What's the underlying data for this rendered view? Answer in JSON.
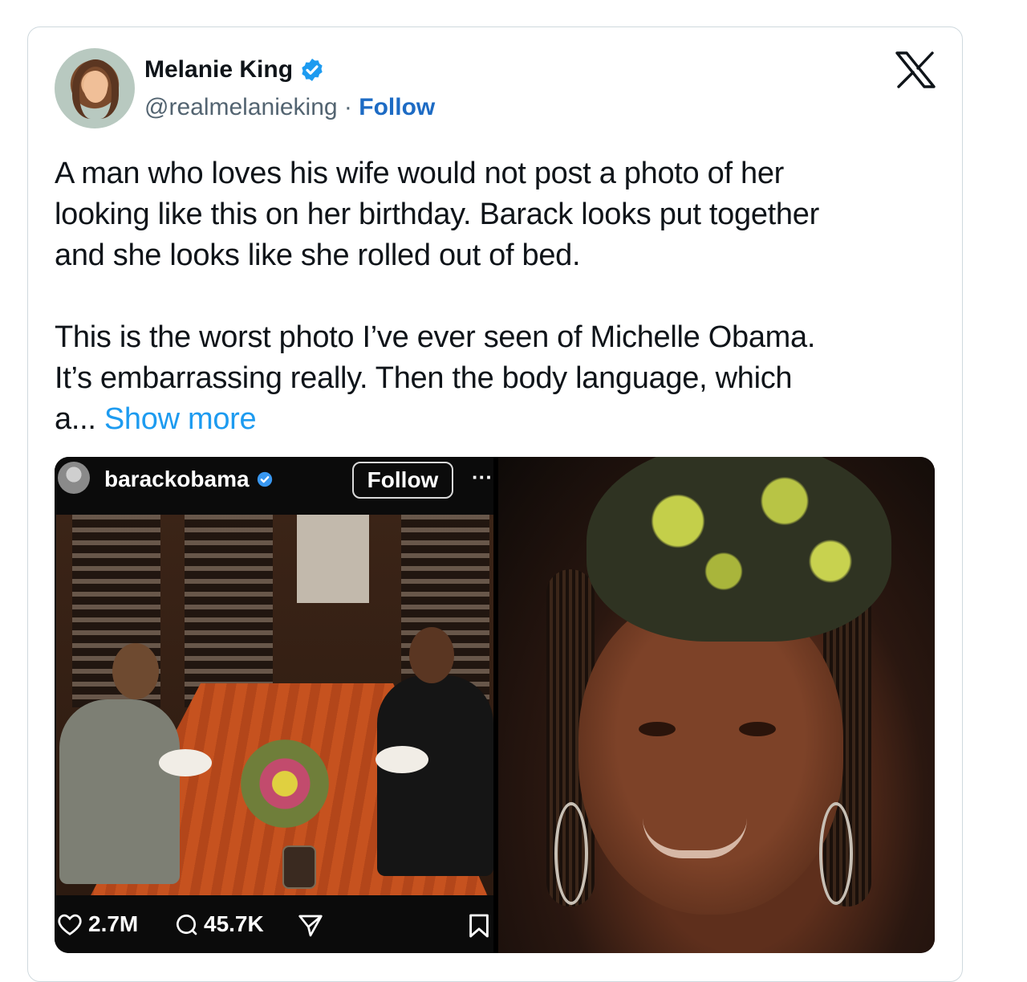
{
  "tweet": {
    "author_name": "Melanie King",
    "handle": "@realmelanieking",
    "separator": "·",
    "follow_label": "Follow",
    "text": "A man who loves his wife would not post a photo of her\nlooking like this on her birthday. Barack looks put together\nand she looks like she rolled out of bed.\n\nThis is the worst photo I’ve ever seen of Michelle Obama.\nIt’s embarrassing really.  Then the body language, which\na... ",
    "show_more_label": "Show more"
  },
  "instagram": {
    "username": "barackobama",
    "follow_label": "Follow",
    "more_label": "···",
    "likes": "2.7M",
    "comments": "45.7K"
  },
  "icons": {
    "verified": "verified-badge-icon",
    "brand": "x-logo-icon",
    "like": "heart-icon",
    "comment": "comment-icon",
    "share": "share-icon",
    "save": "bookmark-icon"
  },
  "colors": {
    "follow_blue": "#1d6bc4",
    "show_more_blue": "#1d9bf0",
    "verified_blue": "#1d9bf0"
  }
}
